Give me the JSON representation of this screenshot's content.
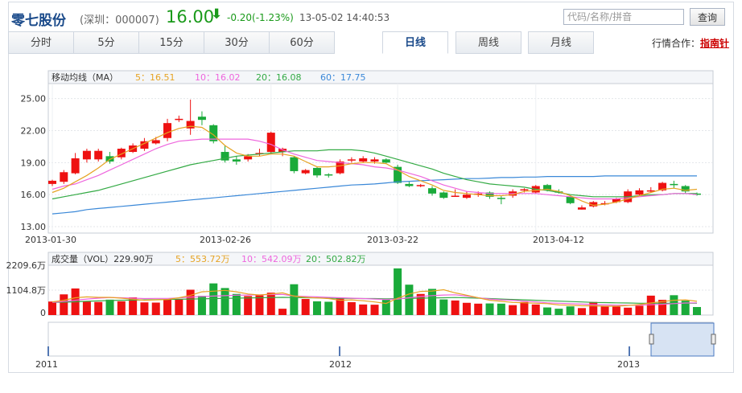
{
  "header": {
    "stock_name": "零七股份",
    "code_text": "(深圳：000007)",
    "price": "16.00",
    "change": "-0.20(-1.23%)",
    "datetime": "13-05-02 14:40:53",
    "search_placeholder": "代码/名称/拼音",
    "search_button": "查询",
    "partner_label": "行情合作：",
    "partner_link": "指南针"
  },
  "tabs": [
    {
      "label": "分时"
    },
    {
      "label": "5分"
    },
    {
      "label": "15分"
    },
    {
      "label": "30分"
    },
    {
      "label": "60分"
    },
    {
      "label": "日线"
    },
    {
      "label": "周线"
    },
    {
      "label": "月线"
    }
  ],
  "active_tab": "日线",
  "colors": {
    "up": "#ee1111",
    "down": "#1aaa3a",
    "ma5": "#e6a323",
    "ma10": "#ee66dd",
    "ma20": "#33aa44",
    "ma60": "#3a88d8"
  },
  "price_legend": [
    {
      "label": "移动均线（MA）",
      "color": "#333333"
    },
    {
      "label": "5：16.51",
      "color": "#e6a323"
    },
    {
      "label": "10：16.02",
      "color": "#ee66dd"
    },
    {
      "label": "20：16.08",
      "color": "#33aa44"
    },
    {
      "label": "60：17.75",
      "color": "#3a88d8"
    }
  ],
  "vol_legend": [
    {
      "label": "成交量（VOL）229.90万",
      "color": "#333333"
    },
    {
      "label": "5：553.72万",
      "color": "#e6a323"
    },
    {
      "label": "10：542.09万",
      "color": "#ee66dd"
    },
    {
      "label": "20：502.82万",
      "color": "#33aa44"
    }
  ],
  "navigator_years": [
    "2011",
    "2012",
    "2013"
  ],
  "chart_data": {
    "type": "candlestick",
    "y_ticks": [
      "25.00",
      "22.00",
      "19.00",
      "16.00",
      "13.00"
    ],
    "ylim": [
      12.4,
      26.4
    ],
    "x_ticks": [
      "2013-01-30",
      "2013-02-26",
      "2013-03-22",
      "2013-04-12"
    ],
    "vol_ticks": [
      "2209.6万",
      "1104.8万",
      "0"
    ],
    "vol_max": 2209.6,
    "candles": [
      [
        17.0,
        17.3,
        16.8,
        17.4
      ],
      [
        17.2,
        18.1,
        17.0,
        18.3
      ],
      [
        18.0,
        19.4,
        17.9,
        19.9
      ],
      [
        19.3,
        20.1,
        19.0,
        20.3
      ],
      [
        19.3,
        20.1,
        19.1,
        20.3
      ],
      [
        19.6,
        19.1,
        18.9,
        20.0
      ],
      [
        19.5,
        20.3,
        19.3,
        20.4
      ],
      [
        20.0,
        20.6,
        19.9,
        20.8
      ],
      [
        20.3,
        21.0,
        20.1,
        21.3
      ],
      [
        20.8,
        21.1,
        20.7,
        21.4
      ],
      [
        21.3,
        22.7,
        21.0,
        23.1
      ],
      [
        23.1,
        23.1,
        22.8,
        23.4
      ],
      [
        22.2,
        22.9,
        21.6,
        24.9
      ],
      [
        23.3,
        23.0,
        22.5,
        23.8
      ],
      [
        22.5,
        21.0,
        20.8,
        22.6
      ],
      [
        20.0,
        19.2,
        19.0,
        20.6
      ],
      [
        19.3,
        19.1,
        18.8,
        19.6
      ],
      [
        19.3,
        19.6,
        19.1,
        19.8
      ],
      [
        19.8,
        19.9,
        19.6,
        20.3
      ],
      [
        20.0,
        21.8,
        19.8,
        21.9
      ],
      [
        20.0,
        20.3,
        19.6,
        20.4
      ],
      [
        19.5,
        18.2,
        18.0,
        19.6
      ],
      [
        18.0,
        18.3,
        17.9,
        18.4
      ],
      [
        18.5,
        17.8,
        17.6,
        18.6
      ],
      [
        17.9,
        17.8,
        17.6,
        18.0
      ],
      [
        18.0,
        19.1,
        17.9,
        19.3
      ],
      [
        19.2,
        19.3,
        19.0,
        19.5
      ],
      [
        19.1,
        19.4,
        19.0,
        19.6
      ],
      [
        19.1,
        19.3,
        18.9,
        19.5
      ],
      [
        19.3,
        19.0,
        18.9,
        19.4
      ],
      [
        18.6,
        17.1,
        17.0,
        18.8
      ],
      [
        17.0,
        16.8,
        16.7,
        17.2
      ],
      [
        16.9,
        16.9,
        16.7,
        17.0
      ],
      [
        16.6,
        16.1,
        15.9,
        16.8
      ],
      [
        16.2,
        15.7,
        15.6,
        16.3
      ],
      [
        15.9,
        15.9,
        15.8,
        16.5
      ],
      [
        15.7,
        16.0,
        15.6,
        16.3
      ],
      [
        16.0,
        16.1,
        15.8,
        16.3
      ],
      [
        16.2,
        15.8,
        15.6,
        16.3
      ],
      [
        15.7,
        15.6,
        15.1,
        15.9
      ],
      [
        15.9,
        16.3,
        15.7,
        16.5
      ],
      [
        16.4,
        16.5,
        16.2,
        16.6
      ],
      [
        16.2,
        16.8,
        16.1,
        16.9
      ],
      [
        16.9,
        16.4,
        16.3,
        17.0
      ],
      [
        16.3,
        16.2,
        16.1,
        16.5
      ],
      [
        15.8,
        15.2,
        15.1,
        15.9
      ],
      [
        14.6,
        14.8,
        14.6,
        15.0
      ],
      [
        14.9,
        15.3,
        14.8,
        15.4
      ],
      [
        15.1,
        15.2,
        15.0,
        15.4
      ],
      [
        15.3,
        15.6,
        15.2,
        15.7
      ],
      [
        15.3,
        16.3,
        15.2,
        16.5
      ],
      [
        16.0,
        16.4,
        15.9,
        16.6
      ],
      [
        16.3,
        16.4,
        16.2,
        16.7
      ],
      [
        16.4,
        17.1,
        16.3,
        17.2
      ],
      [
        17.0,
        16.9,
        16.6,
        17.3
      ],
      [
        16.8,
        16.3,
        16.1,
        16.9
      ],
      [
        16.1,
        16.0,
        15.9,
        16.2
      ]
    ],
    "volumes": [
      640,
      980,
      1260,
      640,
      620,
      730,
      650,
      840,
      600,
      590,
      740,
      760,
      1200,
      910,
      1500,
      1280,
      1000,
      900,
      930,
      1060,
      300,
      1460,
      760,
      650,
      630,
      790,
      610,
      500,
      490,
      720,
      2209.6,
      1440,
      1000,
      1240,
      740,
      690,
      580,
      540,
      550,
      540,
      470,
      620,
      500,
      360,
      300,
      410,
      330,
      620,
      420,
      400,
      350,
      440,
      920,
      720,
      940,
      680,
      380,
      250
    ],
    "ma5": [
      16.2,
      16.6,
      17.2,
      17.8,
      18.5,
      19.3,
      19.8,
      20.3,
      20.8,
      21.3,
      21.8,
      22.2,
      22.4,
      22.3,
      21.6,
      20.6,
      19.9,
      19.6,
      19.6,
      19.8,
      19.8,
      19.6,
      19.1,
      18.6,
      18.6,
      18.7,
      18.9,
      19.0,
      19.0,
      18.9,
      18.3,
      17.7,
      17.3,
      16.9,
      16.4,
      16.2,
      16.1,
      16.0,
      15.9,
      15.9,
      16.0,
      16.3,
      16.4,
      16.5,
      16.3,
      15.9,
      15.4,
      15.0,
      15.1,
      15.3,
      15.6,
      15.9,
      16.2,
      16.5,
      16.6,
      16.4,
      16.5
    ],
    "ma10": [
      16.5,
      16.8,
      17.0,
      17.4,
      17.8,
      18.3,
      18.8,
      19.3,
      19.8,
      20.3,
      20.7,
      21.0,
      21.1,
      21.2,
      21.2,
      21.2,
      21.2,
      21.2,
      21.0,
      20.7,
      20.2,
      19.8,
      19.5,
      19.2,
      19.1,
      19.0,
      18.9,
      18.8,
      18.6,
      18.5,
      18.3,
      18.0,
      17.7,
      17.3,
      16.9,
      16.6,
      16.3,
      16.2,
      16.1,
      16.1,
      16.1,
      16.1,
      16.1,
      16.0,
      15.9,
      15.8,
      15.7,
      15.6,
      15.6,
      15.6,
      15.7,
      15.8,
      15.9,
      16.0,
      16.1,
      16.1,
      16.0
    ],
    "ma20": [
      15.6,
      15.8,
      16.0,
      16.2,
      16.4,
      16.7,
      17.0,
      17.3,
      17.6,
      17.9,
      18.2,
      18.5,
      18.8,
      19.0,
      19.2,
      19.4,
      19.6,
      19.7,
      19.8,
      19.9,
      20.0,
      20.1,
      20.1,
      20.1,
      20.2,
      20.2,
      20.2,
      20.1,
      19.9,
      19.6,
      19.3,
      19.0,
      18.7,
      18.4,
      18.0,
      17.7,
      17.4,
      17.2,
      17.0,
      16.9,
      16.8,
      16.7,
      16.5,
      16.4,
      16.2,
      16.0,
      15.9,
      15.8,
      15.8,
      15.8,
      15.8,
      15.9,
      16.0,
      16.0,
      16.1,
      16.1,
      16.1
    ],
    "ma60": [
      14.2,
      14.3,
      14.4,
      14.6,
      14.7,
      14.8,
      14.9,
      15.0,
      15.1,
      15.2,
      15.3,
      15.4,
      15.5,
      15.6,
      15.7,
      15.8,
      15.9,
      16.0,
      16.1,
      16.2,
      16.3,
      16.4,
      16.5,
      16.6,
      16.7,
      16.8,
      16.9,
      16.95,
      17.0,
      17.1,
      17.2,
      17.25,
      17.3,
      17.35,
      17.4,
      17.45,
      17.5,
      17.5,
      17.55,
      17.6,
      17.6,
      17.65,
      17.65,
      17.7,
      17.7,
      17.7,
      17.7,
      17.7,
      17.75,
      17.75,
      17.75,
      17.75,
      17.75,
      17.75,
      17.75,
      17.75,
      17.75
    ],
    "vol_ma5": [
      620,
      700,
      820,
      860,
      840,
      840,
      800,
      750,
      700,
      720,
      740,
      820,
      930,
      1100,
      1130,
      1170,
      1100,
      1000,
      950,
      1000,
      1050,
      900,
      840,
      810,
      780,
      700,
      720,
      680,
      620,
      550,
      800,
      1000,
      1120,
      1140,
      1200,
      1050,
      940,
      820,
      700,
      650,
      600,
      580,
      560,
      540,
      480,
      470,
      440,
      440,
      420,
      420,
      450,
      500,
      570,
      640,
      700,
      720,
      650,
      520
    ],
    "vol_ma10": [
      600,
      640,
      700,
      760,
      800,
      830,
      820,
      800,
      780,
      790,
      790,
      810,
      850,
      880,
      900,
      920,
      940,
      950,
      960,
      970,
      980,
      900,
      880,
      860,
      840,
      820,
      800,
      780,
      760,
      740,
      760,
      820,
      880,
      920,
      950,
      960,
      900,
      820,
      760,
      720,
      700,
      660,
      620,
      580,
      560,
      540,
      520,
      500,
      480,
      470,
      460,
      470,
      490,
      510,
      540,
      570,
      580,
      560
    ],
    "vol_ma20": [
      600,
      610,
      630,
      650,
      670,
      690,
      700,
      710,
      720,
      730,
      740,
      750,
      760,
      770,
      780,
      790,
      800,
      810,
      820,
      830,
      840,
      830,
      820,
      810,
      800,
      790,
      790,
      780,
      780,
      770,
      780,
      790,
      800,
      810,
      820,
      830,
      820,
      800,
      780,
      760,
      740,
      720,
      700,
      680,
      660,
      640,
      620,
      600,
      590,
      580,
      570,
      560,
      560,
      560,
      560,
      560,
      560,
      540
    ]
  }
}
